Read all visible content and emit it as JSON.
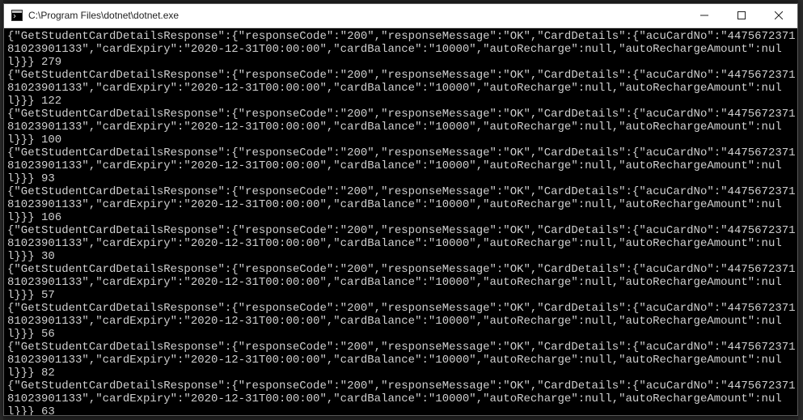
{
  "window": {
    "title": "C:\\Program Files\\dotnet\\dotnet.exe",
    "icon": "console-icon",
    "controls": {
      "minimize": "—",
      "maximize": "▢",
      "close": "✕"
    }
  },
  "console": {
    "records": [
      {
        "json": {
          "GetStudentCardDetailsResponse": {
            "responseCode": "200",
            "responseMessage": "OK",
            "CardDetails": {
              "acuCardNo": "447567237181023901133",
              "cardExpiry": "2020-12-31T00:00:00",
              "cardBalance": "10000",
              "autoRecharge": null,
              "autoRechargeAmount": null
            }
          }
        },
        "ms": 279
      },
      {
        "json": {
          "GetStudentCardDetailsResponse": {
            "responseCode": "200",
            "responseMessage": "OK",
            "CardDetails": {
              "acuCardNo": "447567237181023901133",
              "cardExpiry": "2020-12-31T00:00:00",
              "cardBalance": "10000",
              "autoRecharge": null,
              "autoRechargeAmount": null
            }
          }
        },
        "ms": 122
      },
      {
        "json": {
          "GetStudentCardDetailsResponse": {
            "responseCode": "200",
            "responseMessage": "OK",
            "CardDetails": {
              "acuCardNo": "447567237181023901133",
              "cardExpiry": "2020-12-31T00:00:00",
              "cardBalance": "10000",
              "autoRecharge": null,
              "autoRechargeAmount": null
            }
          }
        },
        "ms": 100
      },
      {
        "json": {
          "GetStudentCardDetailsResponse": {
            "responseCode": "200",
            "responseMessage": "OK",
            "CardDetails": {
              "acuCardNo": "447567237181023901133",
              "cardExpiry": "2020-12-31T00:00:00",
              "cardBalance": "10000",
              "autoRecharge": null,
              "autoRechargeAmount": null
            }
          }
        },
        "ms": 93
      },
      {
        "json": {
          "GetStudentCardDetailsResponse": {
            "responseCode": "200",
            "responseMessage": "OK",
            "CardDetails": {
              "acuCardNo": "447567237181023901133",
              "cardExpiry": "2020-12-31T00:00:00",
              "cardBalance": "10000",
              "autoRecharge": null,
              "autoRechargeAmount": null
            }
          }
        },
        "ms": 106
      },
      {
        "json": {
          "GetStudentCardDetailsResponse": {
            "responseCode": "200",
            "responseMessage": "OK",
            "CardDetails": {
              "acuCardNo": "447567237181023901133",
              "cardExpiry": "2020-12-31T00:00:00",
              "cardBalance": "10000",
              "autoRecharge": null,
              "autoRechargeAmount": null
            }
          }
        },
        "ms": 30
      },
      {
        "json": {
          "GetStudentCardDetailsResponse": {
            "responseCode": "200",
            "responseMessage": "OK",
            "CardDetails": {
              "acuCardNo": "447567237181023901133",
              "cardExpiry": "2020-12-31T00:00:00",
              "cardBalance": "10000",
              "autoRecharge": null,
              "autoRechargeAmount": null
            }
          }
        },
        "ms": 57
      },
      {
        "json": {
          "GetStudentCardDetailsResponse": {
            "responseCode": "200",
            "responseMessage": "OK",
            "CardDetails": {
              "acuCardNo": "447567237181023901133",
              "cardExpiry": "2020-12-31T00:00:00",
              "cardBalance": "10000",
              "autoRecharge": null,
              "autoRechargeAmount": null
            }
          }
        },
        "ms": 56
      },
      {
        "json": {
          "GetStudentCardDetailsResponse": {
            "responseCode": "200",
            "responseMessage": "OK",
            "CardDetails": {
              "acuCardNo": "447567237181023901133",
              "cardExpiry": "2020-12-31T00:00:00",
              "cardBalance": "10000",
              "autoRecharge": null,
              "autoRechargeAmount": null
            }
          }
        },
        "ms": 82
      },
      {
        "json": {
          "GetStudentCardDetailsResponse": {
            "responseCode": "200",
            "responseMessage": "OK",
            "CardDetails": {
              "acuCardNo": "447567237181023901133",
              "cardExpiry": "2020-12-31T00:00:00",
              "cardBalance": "10000",
              "autoRecharge": null,
              "autoRechargeAmount": null
            }
          }
        },
        "ms": 63
      }
    ]
  }
}
